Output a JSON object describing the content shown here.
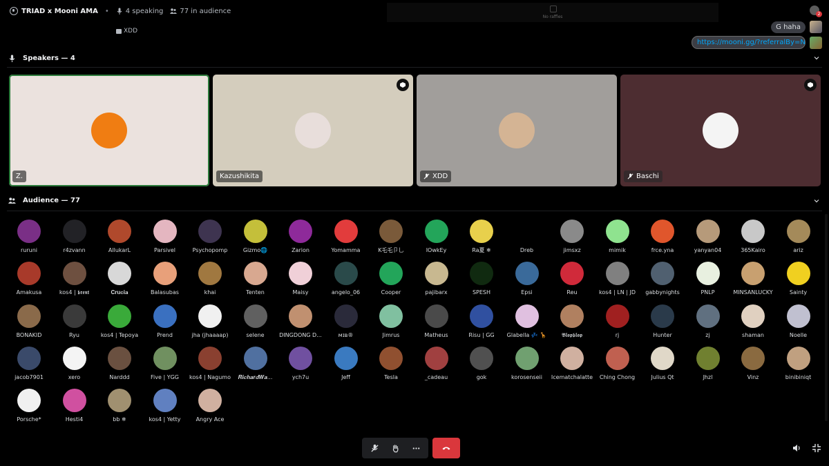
{
  "header": {
    "title": "TRIAD x Mooni AMA",
    "speaking": "4 speaking",
    "audience_count": "77 in audience",
    "raffles": "No raffles",
    "notification_count": "2"
  },
  "chat": {
    "xdd_message": "XDD",
    "messages": [
      "G haha",
      "https://mooni.gg/?referralBy=NH..."
    ]
  },
  "speakers_section": {
    "title": "Speakers — 4"
  },
  "speakers": [
    {
      "name": "Z.",
      "bg": "#ebe2de",
      "avatar": "#f07d12",
      "muted": false,
      "mod": false,
      "active": true
    },
    {
      "name": "Kazushikita",
      "bg": "#d4cdbd",
      "avatar": "#e8dedb",
      "muted": false,
      "mod": true,
      "active": false
    },
    {
      "name": "XDD",
      "bg": "#a19e9b",
      "avatar": "#d4b494",
      "muted": true,
      "mod": false,
      "active": false
    },
    {
      "name": "Baschi",
      "bg": "#4d2d31",
      "avatar": "#f4f4f4",
      "muted": true,
      "mod": true,
      "active": false
    }
  ],
  "audience_section": {
    "title": "Audience — 77"
  },
  "audience": [
    [
      {
        "name": "ruruni",
        "color": "#7a2f86"
      },
      {
        "name": "r4zvann",
        "color": "#222226"
      },
      {
        "name": "AllukarL",
        "color": "#b0492c"
      },
      {
        "name": "Parsivel",
        "color": "#e4b6c0"
      },
      {
        "name": "Psychopomp",
        "color": "#3e3450"
      },
      {
        "name": "Gizmo🌐",
        "color": "#c4bf3a"
      },
      {
        "name": "Zarion",
        "color": "#8e2a9a"
      },
      {
        "name": "Yomamma",
        "color": "#e23c3c"
      },
      {
        "name": "K乇乇卩乚",
        "color": "#7a5a3a"
      },
      {
        "name": "IOwkEy",
        "color": "#23a55a"
      },
      {
        "name": "Ra夏 ❄",
        "color": "#e8d04c"
      },
      {
        "name": "Dreb",
        "color": "#000000"
      },
      {
        "name": "jimsxz",
        "color": "#8a8a8a"
      },
      {
        "name": "mimik",
        "color": "#8fe38f"
      },
      {
        "name": "frce.yna",
        "color": "#e0562c"
      },
      {
        "name": "yanyan04",
        "color": "#b69a7a"
      },
      {
        "name": "365Kairo",
        "color": "#c8c8c8"
      },
      {
        "name": "ariz",
        "color": "#a48a5a"
      }
    ],
    [
      {
        "name": "Amakusa",
        "color": "#a83a2a"
      },
      {
        "name": "kos4 | 𝖇𝖗𝖊𝖓𝖙",
        "color": "#6e5040"
      },
      {
        "name": "𝐂𝐫𝐮𝐜𝐢𝐚",
        "color": "#d8d8d8"
      },
      {
        "name": "Balasubas",
        "color": "#e8a07a"
      },
      {
        "name": "khai",
        "color": "#a07840"
      },
      {
        "name": "Tenten",
        "color": "#d8a890"
      },
      {
        "name": "Maisy",
        "color": "#f0d0d8"
      },
      {
        "name": "angelo_06",
        "color": "#2a4a4a"
      },
      {
        "name": "Cooper",
        "color": "#23a55a"
      },
      {
        "name": "pajibarx",
        "color": "#c8b890"
      },
      {
        "name": "SPESH",
        "color": "#102a10"
      },
      {
        "name": "Epsi",
        "color": "#3a6a9a"
      },
      {
        "name": "Reu",
        "color": "#d02a3a"
      },
      {
        "name": "kos4 | LN | JD",
        "color": "#808080"
      },
      {
        "name": "gabbynights",
        "color": "#506070"
      },
      {
        "name": "PNLP",
        "color": "#e8f0e0"
      },
      {
        "name": "MINSANLUCKY",
        "color": "#c8a070"
      },
      {
        "name": "Sainty",
        "color": "#f0d020"
      }
    ],
    [
      {
        "name": "BONAKID",
        "color": "#8a6a4a"
      },
      {
        "name": "Ryu",
        "color": "#3a3a3a"
      },
      {
        "name": "kos4 | Tepoya",
        "color": "#3aaa3a"
      },
      {
        "name": "Prend",
        "color": "#3a70c0"
      },
      {
        "name": "jha (jhaaaap)",
        "color": "#f0f0f0"
      },
      {
        "name": "selene",
        "color": "#606060"
      },
      {
        "name": "DINGDONG D...",
        "color": "#c09070"
      },
      {
        "name": "ᴍɪʙ®",
        "color": "#2a2a3a"
      },
      {
        "name": "Jimrus",
        "color": "#80c0a0"
      },
      {
        "name": "Matheus",
        "color": "#4a4a4a"
      },
      {
        "name": "Risu | GG",
        "color": "#3050a0"
      },
      {
        "name": "Glabella 💤 🦒",
        "color": "#e0c0e0"
      },
      {
        "name": "𝕭𝖑𝖔𝖕𝖇𝖑𝖔𝖕",
        "color": "#b08060"
      },
      {
        "name": "rj",
        "color": "#a02020"
      },
      {
        "name": "Hunter",
        "color": "#2a3a4a"
      },
      {
        "name": "zj",
        "color": "#607080"
      },
      {
        "name": "shaman",
        "color": "#e0d0c0"
      },
      {
        "name": "Noelle",
        "color": "#c0c0d0"
      }
    ],
    [
      {
        "name": "jacob7901",
        "color": "#3a4a6a"
      },
      {
        "name": "xero",
        "color": "#f4f4f4"
      },
      {
        "name": "Narddd",
        "color": "#6a5040"
      },
      {
        "name": "Five | YGG",
        "color": "#709060"
      },
      {
        "name": "kos4 | Nagumo",
        "color": "#8a4030"
      },
      {
        "name": "𝑹𝒊𝒄𝒉𝒂𝒓𝒅𝑾𝒂...",
        "color": "#5070a0"
      },
      {
        "name": "ych7u",
        "color": "#7050a0"
      },
      {
        "name": "Jeff",
        "color": "#3a7ac0"
      },
      {
        "name": "Tesla",
        "color": "#905030"
      },
      {
        "name": "_cadeau",
        "color": "#a04040"
      },
      {
        "name": "gok",
        "color": "#505050"
      },
      {
        "name": "korosenseii",
        "color": "#70a070"
      },
      {
        "name": "Icematchalatte",
        "color": "#d0b0a0"
      },
      {
        "name": "Ching Chong",
        "color": "#c06050"
      },
      {
        "name": "Julius Qt",
        "color": "#e0d8c8"
      },
      {
        "name": "Jhzl",
        "color": "#708030"
      },
      {
        "name": "Vinz",
        "color": "#8a6a40"
      },
      {
        "name": "binibiniqt",
        "color": "#c0a080"
      }
    ],
    [
      {
        "name": "Porsche*",
        "color": "#f0f0f0"
      },
      {
        "name": "Hesti4",
        "color": "#d050a0"
      },
      {
        "name": "bb ❄",
        "color": "#a09070"
      },
      {
        "name": "kos4 | Yetty",
        "color": "#6080c0"
      },
      {
        "name": "Angry Ace",
        "color": "#d0b0a0"
      }
    ]
  ]
}
